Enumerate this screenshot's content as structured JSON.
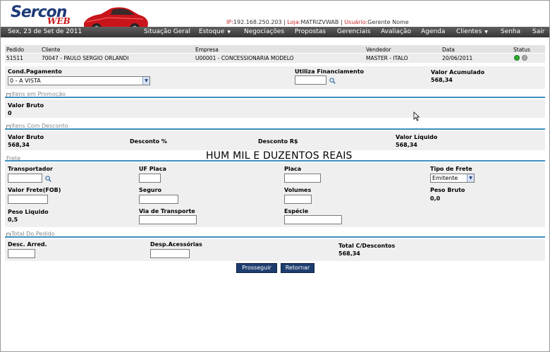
{
  "header": {
    "logo": "Sercon",
    "logo_sub": "WEB",
    "ip_label": "IP:",
    "ip_value": "192.168.250.203",
    "store_label": "Loja:",
    "store_value": "MATRIZVWAB",
    "user_label": "Usuário:",
    "user_value": "Gerente Nome"
  },
  "menubar": {
    "date": "Sex, 23 de Set de 2011",
    "items": [
      "Situação Geral",
      "Estoque",
      "Negociações",
      "Propostas",
      "Gerenciais",
      "Avaliação",
      "Agenda",
      "Clientes",
      "Senha",
      "Sair"
    ]
  },
  "grid": {
    "headers": [
      "Pedido",
      "Cliente",
      "Empresa",
      "Vendedor",
      "Data",
      "Status"
    ],
    "row": [
      "51511",
      "70047 - PAULO SERGIO ORLANDI",
      "U00001 - CONCESSIONARIA MODELO",
      "MASTER - ITALO",
      "20/06/2011"
    ],
    "status_colors": [
      "#2eaa2e",
      "#a8a8a8"
    ]
  },
  "payment": {
    "cond_label": "Cond.Pagamento",
    "cond_value": "0 - A VISTA",
    "financing_label": "Utiliza Financiamento",
    "accum_label": "Valor Acumulado",
    "accum_value": "568,34"
  },
  "promo": {
    "section": "Itens em Promoção",
    "gross_label": "Valor Bruto",
    "gross_value": "0"
  },
  "discount": {
    "section": "Itens Com Desconto",
    "gross_label": "Valor Bruto",
    "gross_value": "568,34",
    "pct_label": "Desconto %",
    "rs_label": "Desconto R$",
    "net_label": "Valor Líquido",
    "net_value": "568,34"
  },
  "amount_in_words": "HUM  MIL E DUZENTOS REAIS",
  "freight": {
    "section": "Frete",
    "carrier_label": "Transportador",
    "uf_label": "UF Placa",
    "plate_label": "Placa",
    "type_label": "Tipo de Frete",
    "type_value": "Emitente",
    "fob_label": "Valor Frete(FOB)",
    "insurance_label": "Seguro",
    "volumes_label": "Volumes",
    "gross_weight_label": "Peso Bruto",
    "gross_weight_value": "0,0",
    "net_weight_label": "Peso Liquido",
    "net_weight_value": "0,5",
    "transport_label": "Via de Transporte",
    "species_label": "Espécie"
  },
  "total": {
    "section": "Total Do Pedido",
    "round_label": "Desc. Arred.",
    "expenses_label": "Desp.Acessórias",
    "total_label": "Total C/Descontos",
    "total_value": "568,34"
  },
  "buttons": {
    "continue": "Prosseguir",
    "back": "Retornar"
  },
  "colors": {
    "menubar": "#4a4a4a",
    "section_line": "#3f8fbf",
    "button": "#1e3d6f",
    "logo_blue": "#1e3a78",
    "logo_red": "#c81818"
  }
}
